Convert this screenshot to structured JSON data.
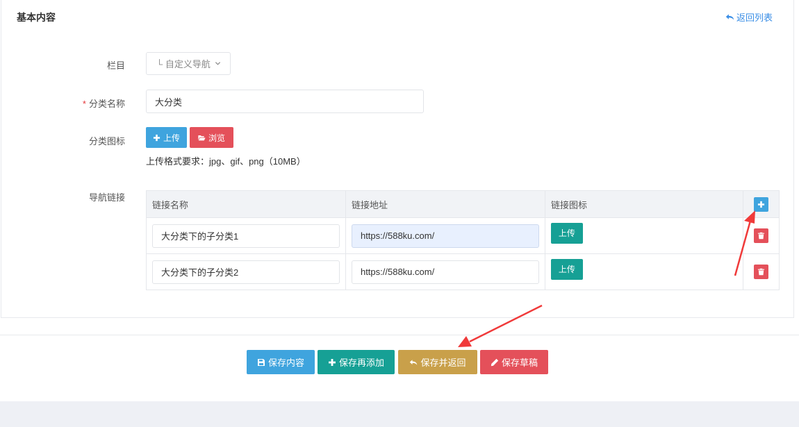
{
  "panel": {
    "title": "基本内容",
    "back_label": "返回列表"
  },
  "form": {
    "column": {
      "label": "栏目",
      "value": "└ 自定义导航"
    },
    "name": {
      "required_mark": "*",
      "label": "分类名称",
      "value": "大分类"
    },
    "icon": {
      "label": "分类图标",
      "upload_label": "上传",
      "browse_label": "浏览",
      "hint": "上传格式要求：jpg、gif、png（10MB）"
    },
    "nav_links": {
      "label": "导航链接",
      "headers": [
        "链接名称",
        "链接地址",
        "链接图标"
      ],
      "rows": [
        {
          "name": "大分类下的子分类1",
          "url": "https://588ku.com/",
          "icon_button": "上传"
        },
        {
          "name": "大分类下的子分类2",
          "url": "https://588ku.com/",
          "icon_button": "上传"
        }
      ]
    }
  },
  "actions": {
    "save_content": "保存内容",
    "save_add": "保存再添加",
    "save_return": "保存并返回",
    "save_draft": "保存草稿"
  },
  "colors": {
    "blue": "#3fa4de",
    "red": "#e4505a",
    "teal": "#16a095",
    "gold": "#c9a04a",
    "annotation": "#f03a3a"
  }
}
